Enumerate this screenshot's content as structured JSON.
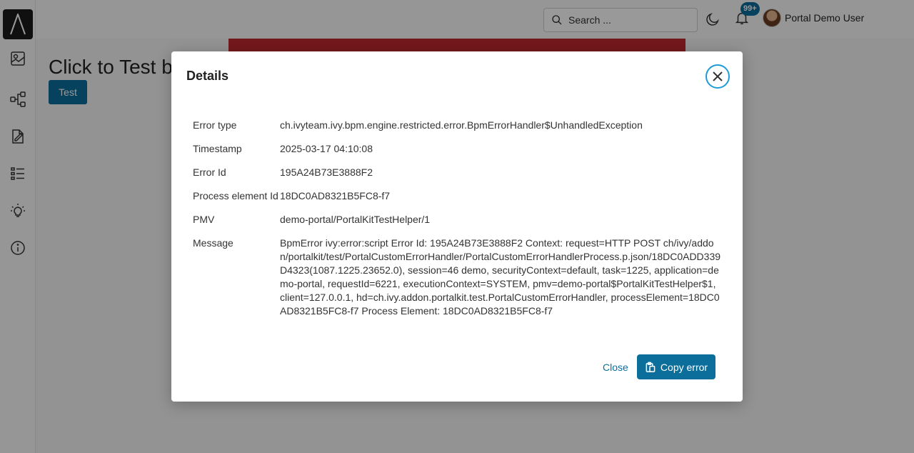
{
  "topbar": {
    "search_placeholder": "Search ...",
    "notification_count": "99+",
    "user_name": "Portal Demo User"
  },
  "sidebar": {
    "items": [
      {
        "icon": "dashboard-icon"
      },
      {
        "icon": "process-icon"
      },
      {
        "icon": "task-icon"
      },
      {
        "icon": "case-list-icon"
      },
      {
        "icon": "idea-icon"
      },
      {
        "icon": "info-icon"
      }
    ]
  },
  "page": {
    "heading": "Click to Test b",
    "test_button": "Test"
  },
  "dialog": {
    "title": "Details",
    "rows": [
      {
        "label": "Error type",
        "value": "ch.ivyteam.ivy.bpm.engine.restricted.error.BpmErrorHandler$UnhandledException"
      },
      {
        "label": "Timestamp",
        "value": "2025-03-17 04:10:08"
      },
      {
        "label": "Error Id",
        "value": "195A24B73E3888F2"
      },
      {
        "label": "Process element Id",
        "value": "18DC0AD8321B5FC8-f7"
      },
      {
        "label": "PMV",
        "value": "demo-portal/PortalKitTestHelper/1"
      },
      {
        "label": "Message",
        "value": "BpmError ivy:error:script Error Id: 195A24B73E3888F2 Context: request=HTTP POST ch/ivy/addon/portalkit/test/PortalCustomErrorHandler/PortalCustomErrorHandlerProcess.p.json/18DC0ADD339D4323(1087.1225.23652.0), session=46 demo, securityContext=default, task=1225, application=demo-portal, requestId=6221, executionContext=SYSTEM, pmv=demo-portal$PortalKitTestHelper$1, client=127.0.0.1, hd=ch.ivy.addon.portalkit.test.PortalCustomErrorHandler, processElement=18DC0AD8321B5FC8-f7 Process Element: 18DC0AD8321B5FC8-f7"
      }
    ],
    "close_label": "Close",
    "copy_label": "Copy error"
  },
  "colors": {
    "primary": "#0b6e9b",
    "focus_ring": "#1e9bd7",
    "error_banner": "#c0282f"
  }
}
